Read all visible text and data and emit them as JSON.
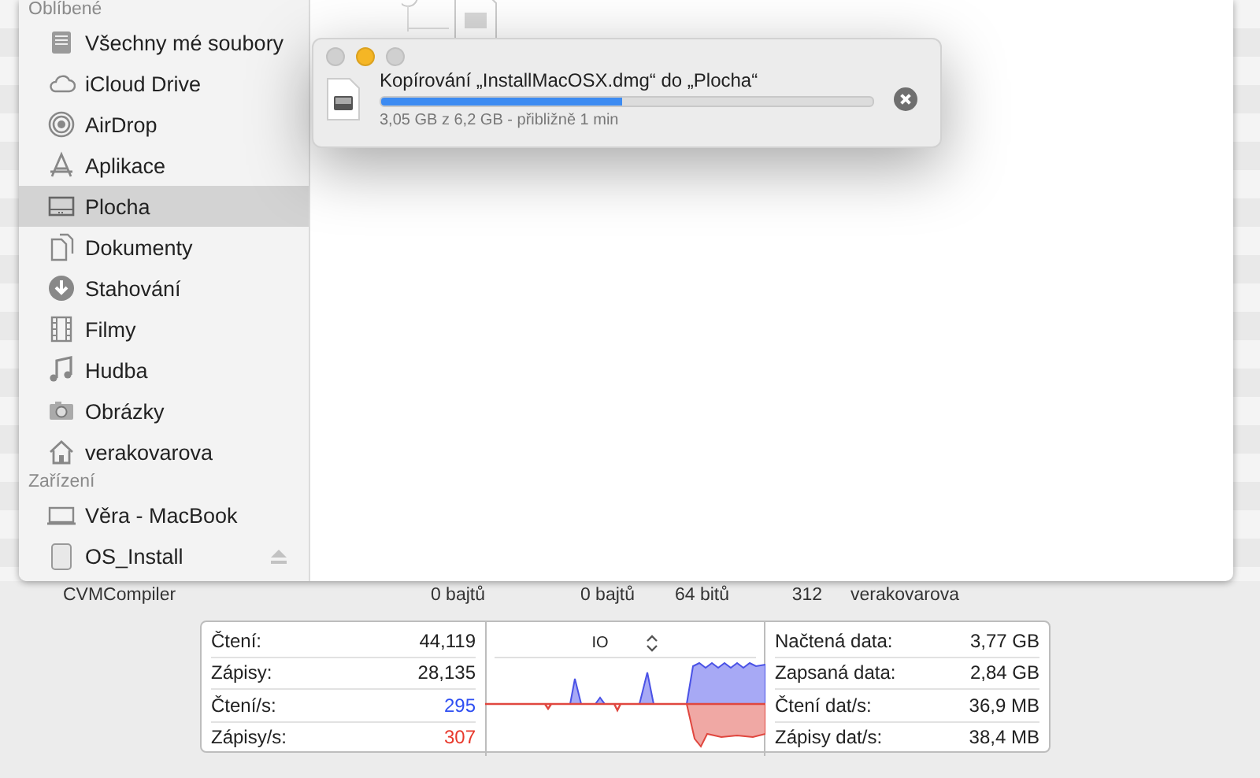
{
  "sidebar": {
    "sections": [
      {
        "title": "Oblíbené",
        "items": [
          {
            "label": "Všechny mé soubory",
            "selected": false
          },
          {
            "label": "iCloud Drive",
            "selected": false
          },
          {
            "label": "AirDrop",
            "selected": false
          },
          {
            "label": "Aplikace",
            "selected": false
          },
          {
            "label": "Plocha",
            "selected": true
          },
          {
            "label": "Dokumenty",
            "selected": false
          },
          {
            "label": "Stahování",
            "selected": false
          },
          {
            "label": "Filmy",
            "selected": false
          },
          {
            "label": "Hudba",
            "selected": false
          },
          {
            "label": "Obrázky",
            "selected": false
          },
          {
            "label": "verakovarova",
            "selected": false
          }
        ]
      },
      {
        "title": "Zařízení",
        "items": [
          {
            "label": "Věra - MacBook",
            "selected": false
          },
          {
            "label": "OS_Install",
            "selected": false
          }
        ]
      }
    ]
  },
  "copy_dialog": {
    "title": "Kopírování „InstallMacOSX.dmg“ do „Plocha“",
    "level": 0.49,
    "detail": "3,05 GB z 6,2 GB - přibližně 1 min"
  },
  "process_row": [
    "CVMCompiler",
    "0 bajtů",
    "0 bajtů",
    "64 bitů",
    "312",
    "verakovarova"
  ],
  "io_panel": {
    "left_stats": [
      {
        "label": "Čtení:",
        "value": "44,119"
      },
      {
        "label": "Zápisy:",
        "value": "28,135"
      },
      {
        "label": "Čtení/s:",
        "value": "295",
        "color": "#2f4ff2"
      },
      {
        "label": "Zápisy/s:",
        "value": "307",
        "color": "#e8392c"
      }
    ],
    "graph_selector": "IO",
    "right_stats": [
      {
        "label": "Načtená data:",
        "value": "3,77 GB"
      },
      {
        "label": "Zapsaná data:",
        "value": "2,84 GB"
      },
      {
        "label": "Čtení dat/s:",
        "value": "36,9 MB"
      },
      {
        "label": "Zápisy dat/s:",
        "value": "38,4 MB"
      }
    ]
  }
}
